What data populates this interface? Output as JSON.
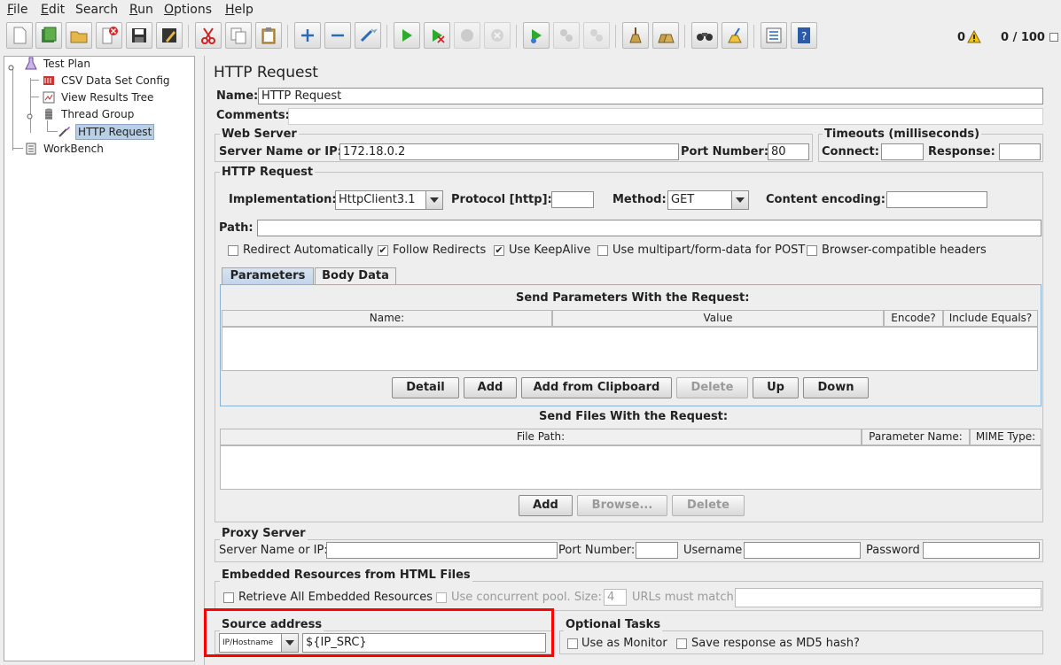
{
  "menu": [
    {
      "first": "F",
      "rest": "ile"
    },
    {
      "first": "E",
      "rest": "dit"
    },
    {
      "first": "",
      "rest": "Search"
    },
    {
      "first": "R",
      "rest": "un"
    },
    {
      "first": "O",
      "rest": "ptions"
    },
    {
      "first": "H",
      "rest": "elp"
    }
  ],
  "status": {
    "warnings": "0",
    "threads": "0 / 100"
  },
  "tree": {
    "items": [
      "Test Plan",
      "CSV Data Set Config",
      "View Results Tree",
      "Thread Group",
      "HTTP Request",
      "WorkBench"
    ]
  },
  "panel": {
    "title": "HTTP Request",
    "name_label": "Name:",
    "name_value": "HTTP Request",
    "comments_label": "Comments:"
  },
  "web_server": {
    "title": "Web Server",
    "server_label": "Server Name or IP:",
    "server_value": "172.18.0.2",
    "port_label": "Port Number:",
    "port_value": "80"
  },
  "timeouts": {
    "title": "Timeouts (milliseconds)",
    "connect_label": "Connect:",
    "response_label": "Response:"
  },
  "http_request": {
    "title": "HTTP Request",
    "impl_label": "Implementation:",
    "impl_value": "HttpClient3.1",
    "protocol_label": "Protocol [http]:",
    "method_label": "Method:",
    "method_value": "GET",
    "encoding_label": "Content encoding:",
    "path_label": "Path:",
    "checkboxes": [
      {
        "label": "Redirect Automatically",
        "checked": false
      },
      {
        "label": "Follow Redirects",
        "checked": true
      },
      {
        "label": "Use KeepAlive",
        "checked": true
      },
      {
        "label": "Use multipart/form-data for POST",
        "checked": false
      },
      {
        "label": "Browser-compatible headers",
        "checked": false
      }
    ]
  },
  "tabs": [
    "Parameters",
    "Body Data"
  ],
  "params": {
    "title": "Send Parameters With the Request:",
    "columns": [
      "Name:",
      "Value",
      "Encode?",
      "Include Equals?"
    ],
    "buttons": [
      "Detail",
      "Add",
      "Add from Clipboard",
      "Delete",
      "Up",
      "Down"
    ]
  },
  "files": {
    "title": "Send Files With the Request:",
    "columns": [
      "File Path:",
      "Parameter Name:",
      "MIME Type:"
    ],
    "buttons": [
      "Add",
      "Browse...",
      "Delete"
    ]
  },
  "proxy": {
    "title": "Proxy Server",
    "server_label": "Server Name or IP:",
    "port_label": "Port Number:",
    "user_label": "Username",
    "pass_label": "Password"
  },
  "embedded": {
    "title": "Embedded Resources from HTML Files",
    "retrieve_label": "Retrieve All Embedded Resources",
    "pool_label": "Use concurrent pool. Size:",
    "pool_value": "4",
    "urls_label": "URLs must match:"
  },
  "source": {
    "title": "Source address",
    "type_value": "IP/Hostname",
    "address_value": "${IP_SRC}",
    "highlight_color": "#ff0000"
  },
  "optional": {
    "title": "Optional Tasks",
    "monitor_label": "Use as Monitor",
    "md5_label": "Save response as MD5 hash?"
  }
}
